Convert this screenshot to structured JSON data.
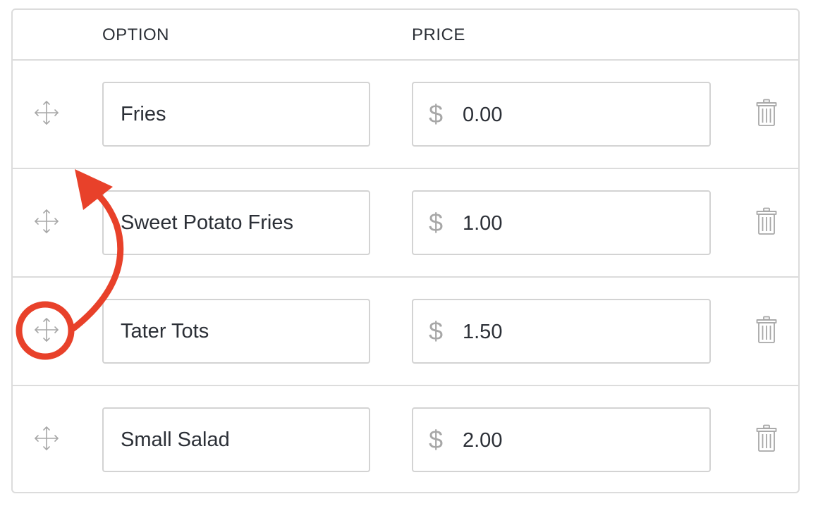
{
  "table": {
    "headers": {
      "option": "OPTION",
      "price": "PRICE"
    },
    "rows": [
      {
        "option": "Fries",
        "currency": "$",
        "price": "0.00"
      },
      {
        "option": "Sweet Potato Fries",
        "currency": "$",
        "price": "1.00"
      },
      {
        "option": "Tater Tots",
        "currency": "$",
        "price": "1.50"
      },
      {
        "option": "Small Salad",
        "currency": "$",
        "price": "2.00"
      }
    ]
  },
  "icons": {
    "drag_handle": "move-arrows-icon",
    "delete": "trash-icon",
    "annotation": "curved-arrow-annotation"
  },
  "colors": {
    "annotation_red": "#e8412a",
    "border": "#dcdcdc",
    "icon_gray": "#a7a7a7",
    "text": "#2b2f36"
  }
}
